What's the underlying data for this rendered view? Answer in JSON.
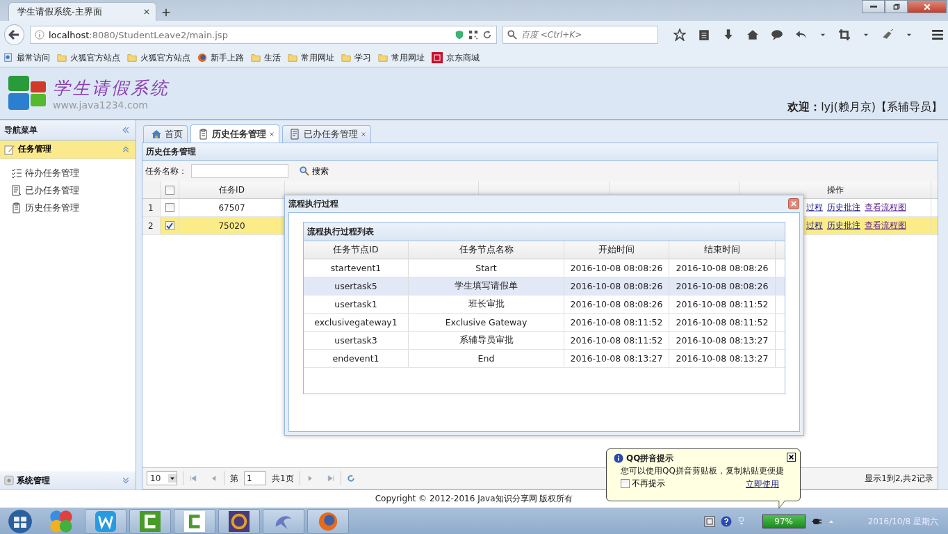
{
  "browser": {
    "tab_title": "学生请假系统-主界面",
    "url_host": "localhost",
    "url_rest": ":8080/StudentLeave2/main.jsp",
    "search_placeholder": "百度 <Ctrl+K>",
    "bookmarks": [
      {
        "label": "最常访问",
        "kind": "special"
      },
      {
        "label": "火狐官方站点",
        "kind": "folder"
      },
      {
        "label": "火狐官方站点",
        "kind": "folder"
      },
      {
        "label": "新手上路",
        "kind": "firefox"
      },
      {
        "label": "生活",
        "kind": "folder"
      },
      {
        "label": "常用网址",
        "kind": "folder"
      },
      {
        "label": "学习",
        "kind": "folder"
      },
      {
        "label": "常用网址",
        "kind": "folder"
      },
      {
        "label": "京东商城",
        "kind": "jd"
      }
    ]
  },
  "header": {
    "logo_title": "学生请假系统",
    "logo_subtitle": "www.java1234.com",
    "welcome": "**欢迎：**lyj(赖月京)【系辅导员】"
  },
  "sidebar": {
    "title": "导航菜单",
    "sections": [
      {
        "label": "任务管理",
        "expanded": true,
        "children": [
          {
            "label": "待办任务管理"
          },
          {
            "label": "已办任务管理"
          },
          {
            "label": "历史任务管理"
          }
        ]
      },
      {
        "label": "系统管理",
        "expanded": false
      }
    ]
  },
  "tabs": [
    {
      "label": "首页",
      "closable": false,
      "selected": false
    },
    {
      "label": "历史任务管理",
      "closable": true,
      "selected": true
    },
    {
      "label": "已办任务管理",
      "closable": true,
      "selected": false
    }
  ],
  "panel": {
    "title": "历史任务管理",
    "search_label": "任务名称：",
    "search_button": "搜索"
  },
  "table": {
    "header_checked": false,
    "columns": [
      "任务ID",
      "操作"
    ],
    "rows": [
      {
        "index": "1",
        "checked": false,
        "selected": false,
        "task_id": "67507",
        "actions": [
          "过程",
          "历史批注",
          "查看流程图"
        ]
      },
      {
        "index": "2",
        "checked": true,
        "selected": true,
        "task_id": "75020",
        "actions": [
          "过程",
          "历史批注",
          "查看流程图"
        ]
      }
    ]
  },
  "pagination": {
    "page_size": "10",
    "page_prefix": "第",
    "page": "1",
    "page_total": "共1页",
    "summary": "显示1到2,共2记录"
  },
  "footer": "Copyright © 2012-2016 Java知识分享网 版权所有",
  "dialog": {
    "title": "流程执行过程",
    "panel_title": "流程执行过程列表",
    "columns": [
      "任务节点ID",
      "任务节点名称",
      "开始时间",
      "结束时间"
    ],
    "rows": [
      {
        "selected": false,
        "cells": [
          "startevent1",
          "Start",
          "2016-10-08 08:08:26",
          "2016-10-08 08:08:26"
        ]
      },
      {
        "selected": true,
        "cells": [
          "usertask5",
          "学生填写请假单",
          "2016-10-08 08:08:26",
          "2016-10-08 08:08:26"
        ]
      },
      {
        "selected": false,
        "cells": [
          "usertask1",
          "班长审批",
          "2016-10-08 08:08:26",
          "2016-10-08 08:11:52"
        ]
      },
      {
        "selected": false,
        "cells": [
          "exclusivegateway1",
          "Exclusive Gateway",
          "2016-10-08 08:11:52",
          "2016-10-08 08:11:52"
        ]
      },
      {
        "selected": false,
        "cells": [
          "usertask3",
          "系辅导员审批",
          "2016-10-08 08:11:52",
          "2016-10-08 08:13:27"
        ]
      },
      {
        "selected": false,
        "cells": [
          "endevent1",
          "End",
          "2016-10-08 08:13:27",
          "2016-10-08 08:13:27"
        ]
      }
    ]
  },
  "tip": {
    "title": "QQ拼音提示",
    "message": "您可以使用QQ拼音剪贴板，复制粘贴更便捷",
    "checkbox_label": "不再提示",
    "checked": false,
    "link": "立即使用"
  },
  "taskbar": {
    "battery": "97%",
    "date": "2016/10/8 星期六"
  }
}
